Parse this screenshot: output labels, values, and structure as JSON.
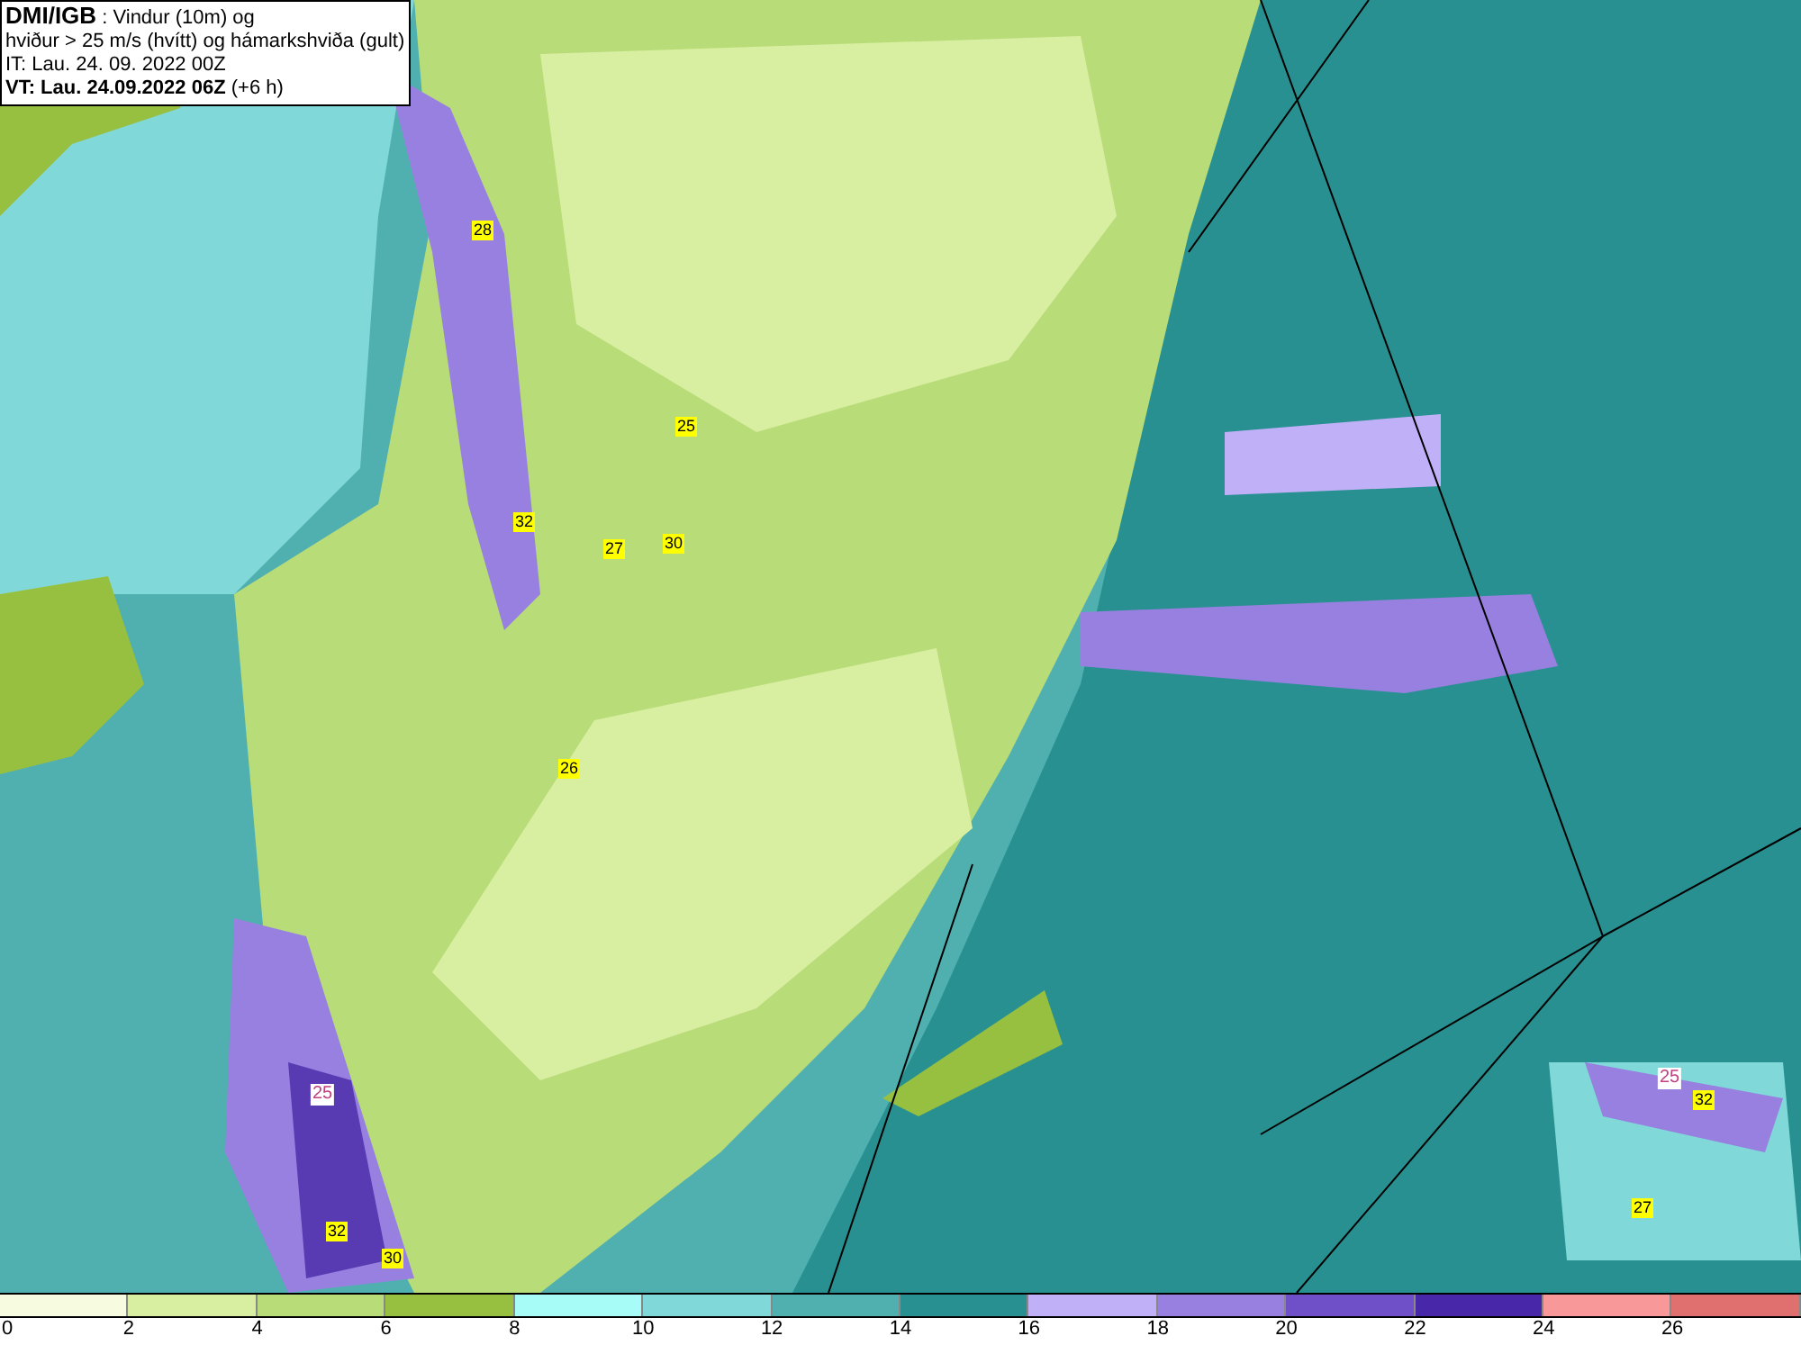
{
  "title_box": {
    "lines": [
      "**DMI/IGB** : Vindur (10m) og",
      "hviður > 25 m/s (hvítt) og hámarkshviða (gult)",
      "IT: Lau. 24. 09. 2022 00Z",
      "**VT: Lau. 24.09.2022 06Z** (+6 h)"
    ]
  },
  "gust_labels": [
    {
      "kind": "max",
      "text": "28"
    },
    {
      "kind": "max",
      "text": "32"
    },
    {
      "kind": "max",
      "text": "25"
    },
    {
      "kind": "max",
      "text": "27"
    },
    {
      "kind": "max",
      "text": "30"
    },
    {
      "kind": "max",
      "text": "26"
    },
    {
      "kind": "contour",
      "text": "25"
    },
    {
      "kind": "max",
      "text": "32"
    },
    {
      "kind": "max",
      "text": "30"
    },
    {
      "kind": "contour",
      "text": "25"
    },
    {
      "kind": "max",
      "text": "32"
    },
    {
      "kind": "max",
      "text": "27"
    }
  ],
  "legend": {
    "swatches": [
      {
        "color": "#f7fce0"
      },
      {
        "color": "#d8eea0"
      },
      {
        "color": "#b8dc78"
      },
      {
        "color": "#98c040"
      },
      {
        "color": "#a8fcf8"
      },
      {
        "color": "#80d8d8"
      },
      {
        "color": "#50b0b0"
      },
      {
        "color": "#289090"
      },
      {
        "color": "#c0b0f8"
      },
      {
        "color": "#9880e0"
      },
      {
        "color": "#7050c8"
      },
      {
        "color": "#4828a8"
      },
      {
        "color": "#f89898"
      },
      {
        "color": "#e07070"
      }
    ],
    "ticks": [
      "0",
      "2",
      "4",
      "6",
      "8",
      "10",
      "12",
      "14",
      "16",
      "18",
      "20",
      "22",
      "24",
      "26"
    ]
  }
}
